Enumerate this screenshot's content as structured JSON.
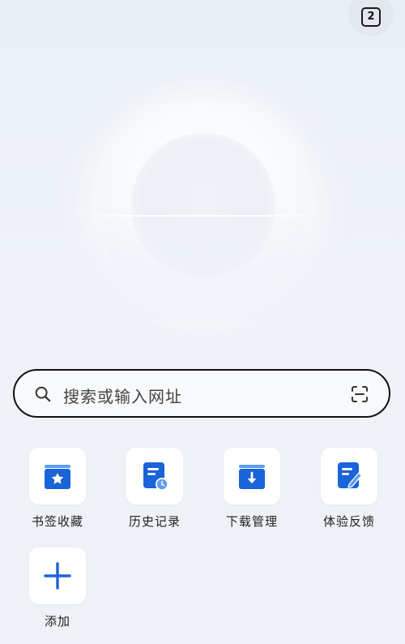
{
  "tabs": {
    "count": "2"
  },
  "search": {
    "placeholder": "搜索或输入网址"
  },
  "shortcuts": [
    {
      "label": "书签收藏",
      "icon": "bookmark-star-icon"
    },
    {
      "label": "历史记录",
      "icon": "history-icon"
    },
    {
      "label": "下载管理",
      "icon": "download-icon"
    },
    {
      "label": "体验反馈",
      "icon": "feedback-icon"
    },
    {
      "label": "添加",
      "icon": "plus-icon"
    }
  ],
  "colors": {
    "accent": "#1a63d8",
    "text": "#222222",
    "background": "#eef2f7"
  }
}
